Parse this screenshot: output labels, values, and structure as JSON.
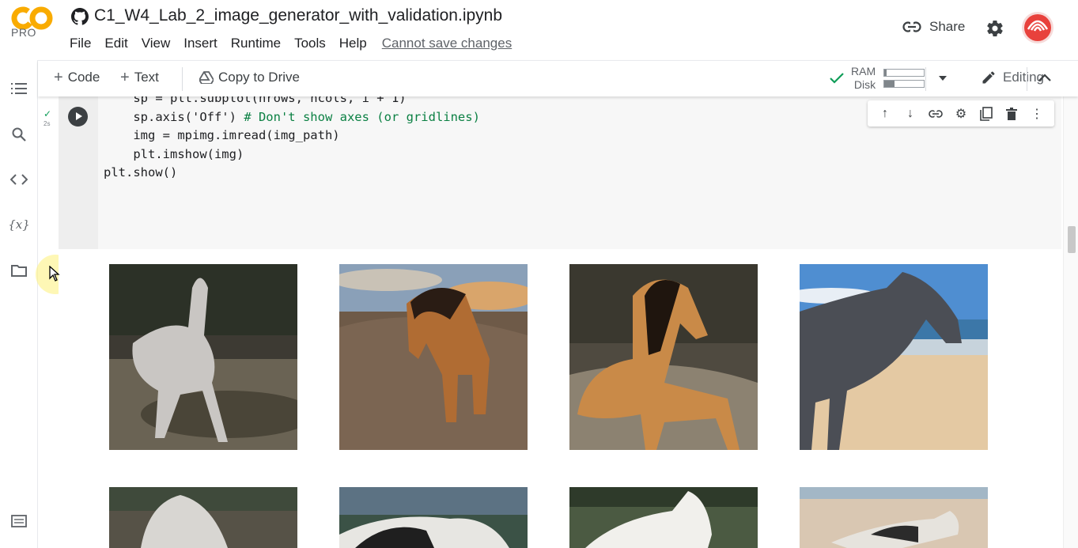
{
  "app": {
    "logo_text": "CO",
    "logo_badge": "PRO",
    "notebook_title": "C1_W4_Lab_2_image_generator_with_validation.ipynb"
  },
  "menu": {
    "items": [
      "File",
      "Edit",
      "View",
      "Insert",
      "Runtime",
      "Tools",
      "Help"
    ],
    "unsaved_notice": "Cannot save changes"
  },
  "header_right": {
    "share_label": "Share"
  },
  "toolbar": {
    "code_label": "Code",
    "text_label": "Text",
    "copy_to_drive_label": "Copy to Drive",
    "ram_label": "RAM",
    "disk_label": "Disk",
    "ram_usage": 0.06,
    "disk_usage": 0.25,
    "editing_label": "Editing"
  },
  "cell": {
    "exec_time": "2s",
    "code_lines": [
      "    sp = plt.subplot(nrows, ncols, i + 1)",
      "    sp.axis('Off') ",
      "",
      "    img = mpimg.imread(img_path)",
      "    plt.imshow(img)",
      "",
      "plt.show()"
    ],
    "comment_line_2": "# Don't show axes (or gridlines)"
  },
  "icons": {
    "rail": [
      "toc-icon",
      "search-icon",
      "code-snippets-icon",
      "variables-icon",
      "files-icon",
      "terminal-icon"
    ],
    "cell_toolbar": [
      "move-up-icon",
      "move-down-icon",
      "link-icon",
      "settings-icon",
      "mirror-cell-icon",
      "delete-icon",
      "more-icon"
    ]
  },
  "colors": {
    "logo_orange": "#f9ab00",
    "run_button": "#3c4043",
    "check_green": "#0f9d58",
    "comment_green": "#0b8043"
  }
}
